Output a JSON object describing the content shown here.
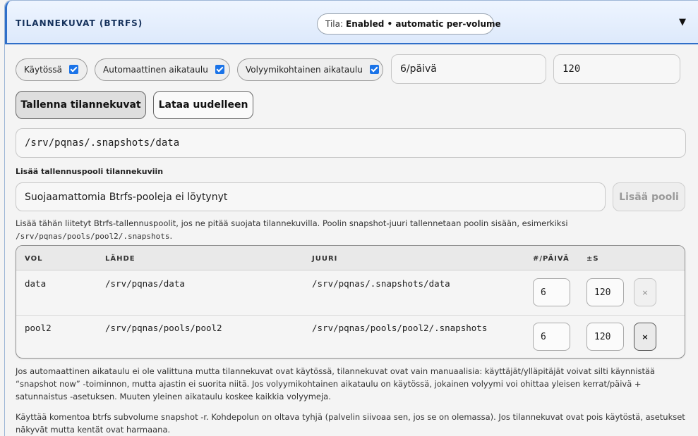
{
  "header": {
    "title": "TILANNEKUVAT (BTRFS)",
    "status_label": "Tila:",
    "status_value": "Enabled • automatic per-volume",
    "collapse_icon": "triangle-down-icon"
  },
  "toggles": [
    {
      "label": "Käytössä",
      "checked": true
    },
    {
      "label": "Automaattinen aikataulu",
      "checked": true
    },
    {
      "label": "Volyymikohtainen aikataulu",
      "checked": true
    }
  ],
  "fields": {
    "per_day": "6/päivä",
    "jitter": "120",
    "snapshot_root": "/srv/pqnas/.snapshots/data"
  },
  "buttons": {
    "save": "Tallenna tilannekuvat",
    "reload": "Lataa uudelleen",
    "add_pool": "Lisää pooli"
  },
  "pool_section": {
    "label": "Lisää tallennuspooli tilannekuviin",
    "select_value": "Suojaamattomia Btrfs-pooleja ei löytynyt",
    "help_text": "Lisää tähän liitetyt Btrfs-tallennuspoolit, jos ne pitää suojata tilannekuvilla. Poolin snapshot-juuri tallennetaan poolin sisään, esimerkiksi",
    "help_code": "/srv/pqnas/pools/pool2/.snapshots",
    "help_suffix": "."
  },
  "table": {
    "columns": [
      "VOL",
      "LÄHDE",
      "JUURI",
      "#/PÄIVÄ",
      "±S"
    ],
    "rows": [
      {
        "vol": "data",
        "source": "/srv/pqnas/data",
        "root": "/srv/pqnas/.snapshots/data",
        "per_day": "6",
        "jitter": "120",
        "remove": "×",
        "remove_enabled": false
      },
      {
        "vol": "pool2",
        "source": "/srv/pqnas/pools/pool2",
        "root": "/srv/pqnas/pools/pool2/.snapshots",
        "per_day": "6",
        "jitter": "120",
        "remove": "×",
        "remove_enabled": true
      }
    ]
  },
  "notes": {
    "p1": "Jos automaattinen aikataulu ei ole valittuna mutta tilannekuvat ovat käytössä, tilannekuvat ovat vain manuaalisia: käyttäjät/ylläpitäjät voivat silti käynnistää “snapshot now” -toiminnon, mutta ajastin ei suorita niitä. Jos volyymikohtainen aikataulu on käytössä, jokainen volyymi voi ohittaa yleisen kerrat/päivä + satunnaistus -asetuksen. Muuten yleinen aikataulu koskee kaikkia volyymeja.",
    "p2": "Käyttää komentoa btrfs subvolume snapshot -r. Kohdepolun on oltava tyhjä (palvelin siivoaa sen, jos se on olemassa). Jos tilannekuvat ovat pois käytöstä, asetukset näkyvät mutta kentät ovat harmaana."
  },
  "colors": {
    "accent": "#2f6fc9",
    "checkbox": "#1a73e8"
  }
}
